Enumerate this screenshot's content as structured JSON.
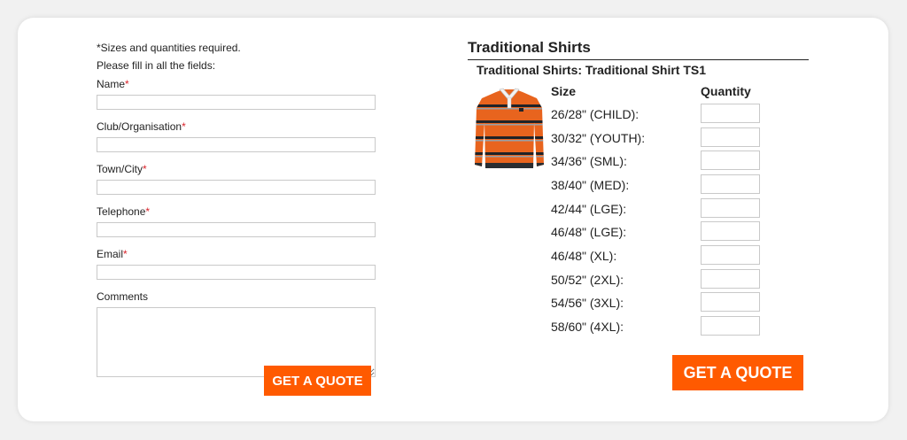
{
  "form": {
    "note_line1": "*Sizes and quantities required.",
    "note_line2": "Please fill in all the fields:",
    "required_marker": "*",
    "fields": [
      {
        "label": "Name",
        "value": "",
        "required": true
      },
      {
        "label": "Club/Organisation",
        "value": "",
        "required": true
      },
      {
        "label": "Town/City",
        "value": "",
        "required": true
      },
      {
        "label": "Telephone",
        "value": "",
        "required": true
      },
      {
        "label": "Email",
        "value": "",
        "required": true
      }
    ],
    "comments": {
      "label": "Comments",
      "value": ""
    },
    "submit_label": "GET A QUOTE"
  },
  "product": {
    "section_title": "Traditional Shirts",
    "title": "Traditional Shirts: Traditional Shirt TS1",
    "image_icon": "rugby-shirt-image",
    "size_header": "Size",
    "quantity_header": "Quantity",
    "sizes": [
      {
        "label": "26/28\" (CHILD):",
        "quantity": ""
      },
      {
        "label": "30/32\" (YOUTH):",
        "quantity": ""
      },
      {
        "label": "34/36\" (SML):",
        "quantity": ""
      },
      {
        "label": "38/40\" (MED):",
        "quantity": ""
      },
      {
        "label": "42/44\" (LGE):",
        "quantity": ""
      },
      {
        "label": "46/48\" (LGE):",
        "quantity": ""
      },
      {
        "label": "46/48\" (XL):",
        "quantity": ""
      },
      {
        "label": "50/52\" (2XL):",
        "quantity": ""
      },
      {
        "label": "54/56\" (3XL):",
        "quantity": ""
      },
      {
        "label": "58/60\" (4XL):",
        "quantity": ""
      }
    ],
    "submit_label": "GET A QUOTE"
  },
  "colors": {
    "accent": "#ff5a00",
    "required": "#d9232a",
    "shirt_body": "#e8641e",
    "shirt_stripe": "#1f2328",
    "shirt_collar": "#f4f4f4"
  }
}
